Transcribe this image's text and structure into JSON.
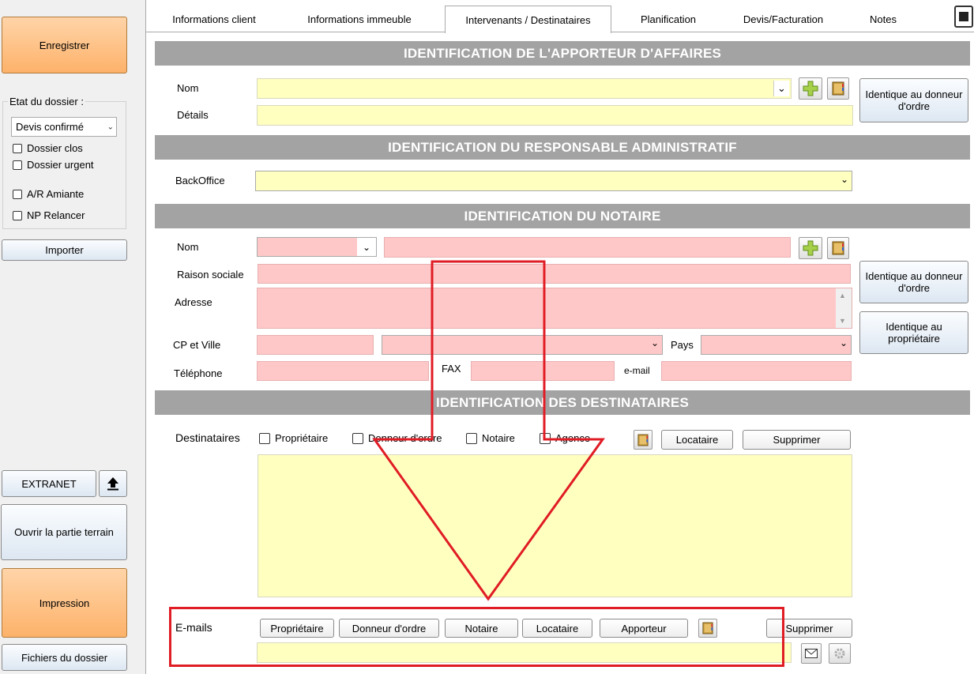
{
  "left": {
    "save_label": "Enregistrer",
    "etat_title": "Etat du dossier :",
    "etat_value": "Devis confirmé",
    "checkboxes": [
      "Dossier clos",
      "Dossier urgent",
      "A/R Amiante",
      "NP Relancer"
    ],
    "import_label": "Importer",
    "extranet_label": "EXTRANET",
    "terrain_label": "Ouvrir la partie terrain",
    "impression_label": "Impression",
    "fichiers_label": "Fichiers du dossier"
  },
  "tabs": [
    "Informations client",
    "Informations immeuble",
    "Intervenants / Destinataires",
    "Planification",
    "Devis/Facturation",
    "Notes"
  ],
  "apporteur": {
    "title": "IDENTIFICATION DE L'APPORTEUR D'AFFAIRES",
    "nom_label": "Nom",
    "details_label": "Détails",
    "identique_label": "Identique au donneur d'ordre"
  },
  "responsable": {
    "title": "IDENTIFICATION DU RESPONSABLE ADMINISTRATIF",
    "backoffice_label": "BackOffice"
  },
  "notaire": {
    "title": "IDENTIFICATION DU NOTAIRE",
    "nom_label": "Nom",
    "raison_label": "Raison sociale",
    "adresse_label": "Adresse",
    "cp_label": "CP et Ville",
    "pays_label": "Pays",
    "tel_label": "Téléphone",
    "fax_label": "FAX",
    "email_label": "e-mail",
    "identique_donneur": "Identique au donneur d'ordre",
    "identique_proprio": "Identique au propriétaire"
  },
  "destinataires": {
    "title": "IDENTIFICATION DES DESTINATAIRES",
    "label": "Destinataires",
    "checks": [
      "Propriétaire",
      "Donneur d'ordre",
      "Notaire",
      "Agence"
    ],
    "locataire_label": "Locataire",
    "supprimer_label": "Supprimer"
  },
  "emails": {
    "label": "E-mails",
    "buttons": [
      "Propriétaire",
      "Donneur d'ordre",
      "Notaire",
      "Locataire",
      "Apporteur"
    ],
    "supprimer_label": "Supprimer"
  },
  "colors": {
    "annotation": "#e01c24",
    "section_bar": "#a3a3a3",
    "field_yellow": "#ffffc0",
    "field_pink": "#ffc8c8"
  }
}
